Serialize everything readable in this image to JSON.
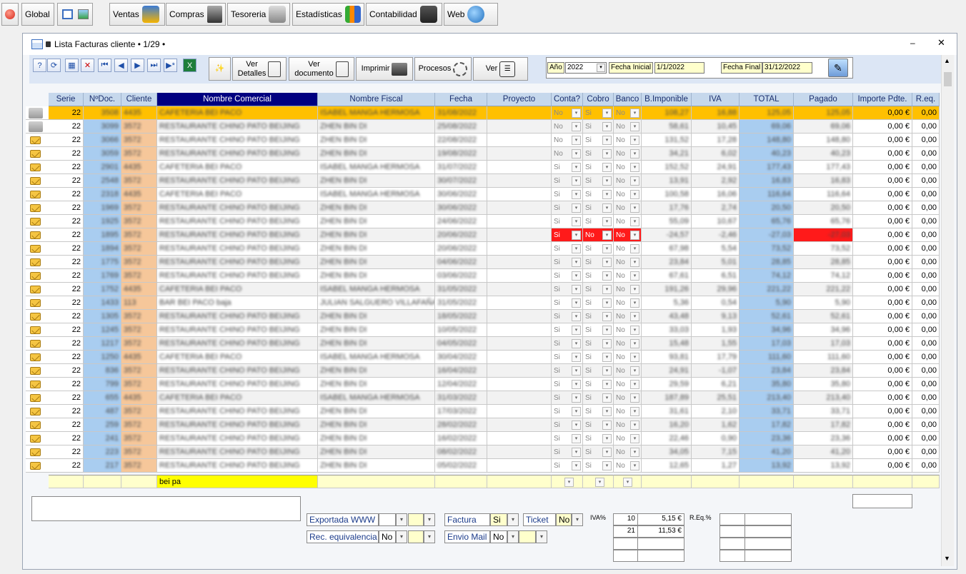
{
  "toolbar": {
    "global": "Global",
    "ventas": "Ventas",
    "compras": "Compras",
    "tesoreria": "Tesoreria",
    "estadisticas": "Estadísticas",
    "contabilidad": "Contabilidad",
    "web": "Web"
  },
  "window": {
    "title": "Lista Facturas cliente • 1/29 •"
  },
  "actions": {
    "ver_detalles_1": "Ver",
    "ver_detalles_2": "Detalles",
    "ver_documento_1": "Ver",
    "ver_documento_2": "documento",
    "imprimir": "Imprimir",
    "procesos": "Procesos",
    "ver": "Ver"
  },
  "filters": {
    "anio_label": "Año",
    "anio_value": "2022",
    "fecha_inicial_label": "Fecha Inicial",
    "fecha_inicial_value": "1/1/2022",
    "fecha_final_label": "Fecha Final",
    "fecha_final_value": "31/12/2022"
  },
  "columns": [
    "Serie",
    "NºDoc.",
    "Cliente",
    "Nombre Comercial",
    "Nombre Fiscal",
    "Fecha",
    "Proyecto",
    "Conta?",
    "Cobro",
    "Banco",
    "B.Imponible",
    "IVA",
    "TOTAL",
    "Pagado",
    "Importe Pdte.",
    "R.eq."
  ],
  "rows": [
    {
      "serie": "22",
      "ndoc": "3508",
      "cliente": "4435",
      "comercial": "CAFETERIA BEI PACO",
      "fiscal": "ISABEL MANGA HERMOSA",
      "fecha": "31/08/2022",
      "conta": "No",
      "cobro": "Si",
      "banco": "No",
      "base": "108,27",
      "iva": "16,88",
      "total": "125,05",
      "pagado": "125,05",
      "pdte": "0,00 €",
      "req": "0,00",
      "icon": "printer"
    },
    {
      "serie": "22",
      "ndoc": "3099",
      "cliente": "3572",
      "comercial": "RESTAURANTE CHINO PATO BEIJING",
      "fiscal": "ZHEN BIN DI",
      "fecha": "25/08/2022",
      "conta": "No",
      "cobro": "Si",
      "banco": "No",
      "base": "58,61",
      "iva": "10,45",
      "total": "69,06",
      "pagado": "69,06",
      "pdte": "0,00 €",
      "req": "0,00",
      "icon": "printer"
    },
    {
      "serie": "22",
      "ndoc": "3066",
      "cliente": "3572",
      "comercial": "RESTAURANTE CHINO PATO BEIJING",
      "fiscal": "ZHEN BIN DI",
      "fecha": "22/08/2022",
      "conta": "No",
      "cobro": "Si",
      "banco": "No",
      "base": "131,52",
      "iva": "17,28",
      "total": "148,80",
      "pagado": "148,80",
      "pdte": "0,00 €",
      "req": "0,00",
      "icon": "mail"
    },
    {
      "serie": "22",
      "ndoc": "3059",
      "cliente": "3572",
      "comercial": "RESTAURANTE CHINO PATO BEIJING",
      "fiscal": "ZHEN BIN DI",
      "fecha": "19/08/2022",
      "conta": "No",
      "cobro": "Si",
      "banco": "No",
      "base": "34,21",
      "iva": "6,02",
      "total": "40,23",
      "pagado": "40,23",
      "pdte": "0,00 €",
      "req": "0,00",
      "icon": "mail"
    },
    {
      "serie": "22",
      "ndoc": "2901",
      "cliente": "4435",
      "comercial": "CAFETERIA BEI PACO",
      "fiscal": "ISABEL MANGA HERMOSA",
      "fecha": "31/07/2022",
      "conta": "Si",
      "cobro": "Si",
      "banco": "No",
      "base": "152,52",
      "iva": "24,91",
      "total": "177,43",
      "pagado": "177,43",
      "pdte": "0,00 €",
      "req": "0,00",
      "icon": "mail"
    },
    {
      "serie": "22",
      "ndoc": "2548",
      "cliente": "3572",
      "comercial": "RESTAURANTE CHINO PATO BEIJING",
      "fiscal": "ZHEN BIN DI",
      "fecha": "30/07/2022",
      "conta": "Si",
      "cobro": "Si",
      "banco": "No",
      "base": "13,91",
      "iva": "2,92",
      "total": "16,83",
      "pagado": "16,83",
      "pdte": "0,00 €",
      "req": "0,00",
      "icon": "mail"
    },
    {
      "serie": "22",
      "ndoc": "2318",
      "cliente": "4435",
      "comercial": "CAFETERIA BEI PACO",
      "fiscal": "ISABEL MANGA HERMOSA",
      "fecha": "30/06/2022",
      "conta": "Si",
      "cobro": "Si",
      "banco": "No",
      "base": "100,58",
      "iva": "16,06",
      "total": "116,64",
      "pagado": "116,64",
      "pdte": "0,00 €",
      "req": "0,00",
      "icon": "mail"
    },
    {
      "serie": "22",
      "ndoc": "1969",
      "cliente": "3572",
      "comercial": "RESTAURANTE CHINO PATO BEIJING",
      "fiscal": "ZHEN BIN DI",
      "fecha": "30/06/2022",
      "conta": "Si",
      "cobro": "Si",
      "banco": "No",
      "base": "17,76",
      "iva": "2,74",
      "total": "20,50",
      "pagado": "20,50",
      "pdte": "0,00 €",
      "req": "0,00",
      "icon": "mail"
    },
    {
      "serie": "22",
      "ndoc": "1925",
      "cliente": "3572",
      "comercial": "RESTAURANTE CHINO PATO BEIJING",
      "fiscal": "ZHEN BIN DI",
      "fecha": "24/06/2022",
      "conta": "Si",
      "cobro": "Si",
      "banco": "No",
      "base": "55,09",
      "iva": "10,67",
      "total": "65,76",
      "pagado": "65,76",
      "pdte": "0,00 €",
      "req": "0,00",
      "icon": "mail"
    },
    {
      "serie": "22",
      "ndoc": "1895",
      "cliente": "3572",
      "comercial": "RESTAURANTE CHINO PATO BEIJING",
      "fiscal": "ZHEN BIN DI",
      "fecha": "20/06/2022",
      "conta": "Si",
      "cobro": "No",
      "banco": "No",
      "base": "-24,57",
      "iva": "-2,46",
      "total": "-27,03",
      "pagado": "-27,03",
      "pdte": "0,00 €",
      "req": "0,00",
      "icon": "mail",
      "red": true
    },
    {
      "serie": "22",
      "ndoc": "1894",
      "cliente": "3572",
      "comercial": "RESTAURANTE CHINO PATO BEIJING",
      "fiscal": "ZHEN BIN DI",
      "fecha": "20/06/2022",
      "conta": "Si",
      "cobro": "Si",
      "banco": "No",
      "base": "67,98",
      "iva": "5,54",
      "total": "73,52",
      "pagado": "73,52",
      "pdte": "0,00 €",
      "req": "0,00",
      "icon": "mail"
    },
    {
      "serie": "22",
      "ndoc": "1775",
      "cliente": "3572",
      "comercial": "RESTAURANTE CHINO PATO BEIJING",
      "fiscal": "ZHEN BIN DI",
      "fecha": "04/06/2022",
      "conta": "Si",
      "cobro": "Si",
      "banco": "No",
      "base": "23,84",
      "iva": "5,01",
      "total": "28,85",
      "pagado": "28,85",
      "pdte": "0,00 €",
      "req": "0,00",
      "icon": "mail"
    },
    {
      "serie": "22",
      "ndoc": "1769",
      "cliente": "3572",
      "comercial": "RESTAURANTE CHINO PATO BEIJING",
      "fiscal": "ZHEN BIN DI",
      "fecha": "03/06/2022",
      "conta": "Si",
      "cobro": "Si",
      "banco": "No",
      "base": "67,61",
      "iva": "6,51",
      "total": "74,12",
      "pagado": "74,12",
      "pdte": "0,00 €",
      "req": "0,00",
      "icon": "mail"
    },
    {
      "serie": "22",
      "ndoc": "1752",
      "cliente": "4435",
      "comercial": "CAFETERIA BEI PACO",
      "fiscal": "ISABEL MANGA HERMOSA",
      "fecha": "31/05/2022",
      "conta": "Si",
      "cobro": "Si",
      "banco": "No",
      "base": "191,26",
      "iva": "29,96",
      "total": "221,22",
      "pagado": "221,22",
      "pdte": "0,00 €",
      "req": "0,00",
      "icon": "mail"
    },
    {
      "serie": "22",
      "ndoc": "1433",
      "cliente": "113",
      "comercial": "BAR BEI PACO baja",
      "fiscal": "JULIAN SALGUERO VILLAFAÑA",
      "fecha": "31/05/2022",
      "conta": "Si",
      "cobro": "Si",
      "banco": "No",
      "base": "5,36",
      "iva": "0,54",
      "total": "5,90",
      "pagado": "5,90",
      "pdte": "0,00 €",
      "req": "0,00",
      "icon": "mail"
    },
    {
      "serie": "22",
      "ndoc": "1305",
      "cliente": "3572",
      "comercial": "RESTAURANTE CHINO PATO BEIJING",
      "fiscal": "ZHEN BIN DI",
      "fecha": "18/05/2022",
      "conta": "Si",
      "cobro": "Si",
      "banco": "No",
      "base": "43,48",
      "iva": "9,13",
      "total": "52,61",
      "pagado": "52,61",
      "pdte": "0,00 €",
      "req": "0,00",
      "icon": "mail"
    },
    {
      "serie": "22",
      "ndoc": "1245",
      "cliente": "3572",
      "comercial": "RESTAURANTE CHINO PATO BEIJING",
      "fiscal": "ZHEN BIN DI",
      "fecha": "10/05/2022",
      "conta": "Si",
      "cobro": "Si",
      "banco": "No",
      "base": "33,03",
      "iva": "1,93",
      "total": "34,96",
      "pagado": "34,96",
      "pdte": "0,00 €",
      "req": "0,00",
      "icon": "mail"
    },
    {
      "serie": "22",
      "ndoc": "1217",
      "cliente": "3572",
      "comercial": "RESTAURANTE CHINO PATO BEIJING",
      "fiscal": "ZHEN BIN DI",
      "fecha": "04/05/2022",
      "conta": "Si",
      "cobro": "Si",
      "banco": "No",
      "base": "15,48",
      "iva": "1,55",
      "total": "17,03",
      "pagado": "17,03",
      "pdte": "0,00 €",
      "req": "0,00",
      "icon": "mail"
    },
    {
      "serie": "22",
      "ndoc": "1250",
      "cliente": "4435",
      "comercial": "CAFETERIA BEI PACO",
      "fiscal": "ISABEL MANGA HERMOSA",
      "fecha": "30/04/2022",
      "conta": "Si",
      "cobro": "Si",
      "banco": "No",
      "base": "93,81",
      "iva": "17,79",
      "total": "111,60",
      "pagado": "111,60",
      "pdte": "0,00 €",
      "req": "0,00",
      "icon": "mail"
    },
    {
      "serie": "22",
      "ndoc": "836",
      "cliente": "3572",
      "comercial": "RESTAURANTE CHINO PATO BEIJING",
      "fiscal": "ZHEN BIN DI",
      "fecha": "16/04/2022",
      "conta": "Si",
      "cobro": "Si",
      "banco": "No",
      "base": "24,91",
      "iva": "-1,07",
      "total": "23,84",
      "pagado": "23,84",
      "pdte": "0,00 €",
      "req": "0,00",
      "icon": "mail"
    },
    {
      "serie": "22",
      "ndoc": "799",
      "cliente": "3572",
      "comercial": "RESTAURANTE CHINO PATO BEIJING",
      "fiscal": "ZHEN BIN DI",
      "fecha": "12/04/2022",
      "conta": "Si",
      "cobro": "Si",
      "banco": "No",
      "base": "29,59",
      "iva": "6,21",
      "total": "35,80",
      "pagado": "35,80",
      "pdte": "0,00 €",
      "req": "0,00",
      "icon": "mail"
    },
    {
      "serie": "22",
      "ndoc": "655",
      "cliente": "4435",
      "comercial": "CAFETERIA BEI PACO",
      "fiscal": "ISABEL MANGA HERMOSA",
      "fecha": "31/03/2022",
      "conta": "Si",
      "cobro": "Si",
      "banco": "No",
      "base": "187,89",
      "iva": "25,51",
      "total": "213,40",
      "pagado": "213,40",
      "pdte": "0,00 €",
      "req": "0,00",
      "icon": "mail"
    },
    {
      "serie": "22",
      "ndoc": "487",
      "cliente": "3572",
      "comercial": "RESTAURANTE CHINO PATO BEIJING",
      "fiscal": "ZHEN BIN DI",
      "fecha": "17/03/2022",
      "conta": "Si",
      "cobro": "Si",
      "banco": "No",
      "base": "31,61",
      "iva": "2,10",
      "total": "33,71",
      "pagado": "33,71",
      "pdte": "0,00 €",
      "req": "0,00",
      "icon": "mail"
    },
    {
      "serie": "22",
      "ndoc": "259",
      "cliente": "3572",
      "comercial": "RESTAURANTE CHINO PATO BEIJING",
      "fiscal": "ZHEN BIN DI",
      "fecha": "28/02/2022",
      "conta": "Si",
      "cobro": "Si",
      "banco": "No",
      "base": "16,20",
      "iva": "1,62",
      "total": "17,82",
      "pagado": "17,82",
      "pdte": "0,00 €",
      "req": "0,00",
      "icon": "mail"
    },
    {
      "serie": "22",
      "ndoc": "241",
      "cliente": "3572",
      "comercial": "RESTAURANTE CHINO PATO BEIJING",
      "fiscal": "ZHEN BIN DI",
      "fecha": "16/02/2022",
      "conta": "Si",
      "cobro": "Si",
      "banco": "No",
      "base": "22,46",
      "iva": "0,90",
      "total": "23,36",
      "pagado": "23,36",
      "pdte": "0,00 €",
      "req": "0,00",
      "icon": "mail"
    },
    {
      "serie": "22",
      "ndoc": "223",
      "cliente": "3572",
      "comercial": "RESTAURANTE CHINO PATO BEIJING",
      "fiscal": "ZHEN BIN DI",
      "fecha": "08/02/2022",
      "conta": "Si",
      "cobro": "Si",
      "banco": "No",
      "base": "34,05",
      "iva": "7,15",
      "total": "41,20",
      "pagado": "41,20",
      "pdte": "0,00 €",
      "req": "0,00",
      "icon": "mail"
    },
    {
      "serie": "22",
      "ndoc": "217",
      "cliente": "3572",
      "comercial": "RESTAURANTE CHINO PATO BEIJING",
      "fiscal": "ZHEN BIN DI",
      "fecha": "05/02/2022",
      "conta": "Si",
      "cobro": "Si",
      "banco": "No",
      "base": "12,65",
      "iva": "1,27",
      "total": "13,92",
      "pagado": "13,92",
      "pdte": "0,00 €",
      "req": "0,00",
      "icon": "mail"
    }
  ],
  "search": {
    "comercial": "bei pa"
  },
  "bottom": {
    "exportada_label": "Exportada WWW",
    "rec_equiv_label": "Rec. equivalencia",
    "rec_equiv_value": "No",
    "factura_label": "Factura",
    "factura_value": "Si",
    "ticket_label": "Ticket",
    "ticket_value": "No",
    "envio_mail_label": "Envio Mail",
    "envio_mail_value": "No",
    "iva_pct_label": "IVA%",
    "req_pct_label": "R.Eq.%",
    "iva_rows": [
      {
        "pct": "10",
        "amount": "5,15 €"
      },
      {
        "pct": "21",
        "amount": "11,53 €"
      }
    ]
  },
  "colors": {
    "selected_row": "#ffc000",
    "total_col": "#a9cdf0",
    "ndoc_col": "#a9cdf0",
    "cliente_col": "#f6c79a",
    "red": "#ff1a1a"
  }
}
